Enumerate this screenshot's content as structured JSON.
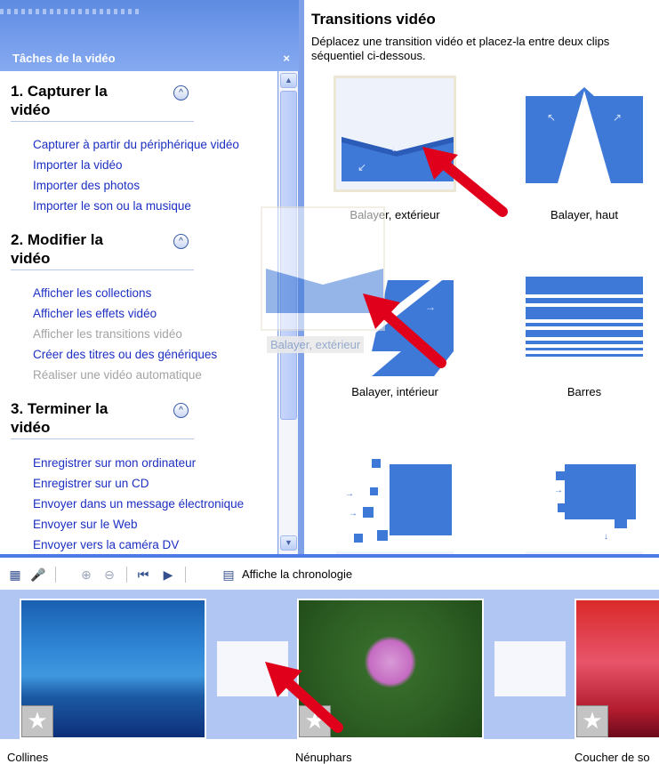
{
  "taskpane": {
    "title": "Tâches de la vidéo",
    "close": "×",
    "sections": [
      {
        "heading_l1": "1. Capturer la",
        "heading_l2": "vidéo",
        "links": [
          "Capturer à partir du périphérique vidéo",
          "Importer la vidéo",
          "Importer des photos",
          "Importer le son ou la musique"
        ]
      },
      {
        "heading_l1": "2. Modifier la",
        "heading_l2": "vidéo",
        "links": [
          "Afficher les collections",
          "Afficher les effets vidéo",
          "Afficher les transitions vidéo",
          "Créer des titres ou des génériques",
          "Réaliser une vidéo automatique"
        ]
      },
      {
        "heading_l1": "3. Terminer la",
        "heading_l2": "vidéo",
        "links": [
          "Enregistrer sur mon ordinateur",
          "Enregistrer sur un CD",
          "Envoyer dans un message électronique",
          "Envoyer sur le Web",
          "Envoyer vers la caméra DV"
        ]
      }
    ],
    "disabled_links": [
      "Afficher les transitions vidéo",
      "Réaliser une vidéo automatique"
    ],
    "chevron": "^"
  },
  "content": {
    "title": "Transitions vidéo",
    "description": "Déplacez une transition vidéo et placez-la entre deux clips séquentiel ci-dessous.",
    "transitions": [
      "Balayer, extérieur",
      "Balayer, haut",
      "Balayer, intérieur",
      "Barres",
      "",
      ""
    ],
    "drag_label": "Balayer, extérieur"
  },
  "toolbar": {
    "timeline_label": "Affiche la chronologie",
    "icons": [
      "storyboard-icon",
      "narrate-icon",
      "zoom-in-icon",
      "zoom-out-icon",
      "rewind-icon",
      "play-icon",
      "timeline-icon"
    ]
  },
  "storyboard": {
    "clips": [
      "Collines",
      "Nénuphars",
      "Coucher de so"
    ]
  },
  "colors": {
    "accent": "#4d7ae8",
    "link": "#1c2fc2",
    "arrow": "#e0001b",
    "panel": "#b2c6f3"
  }
}
